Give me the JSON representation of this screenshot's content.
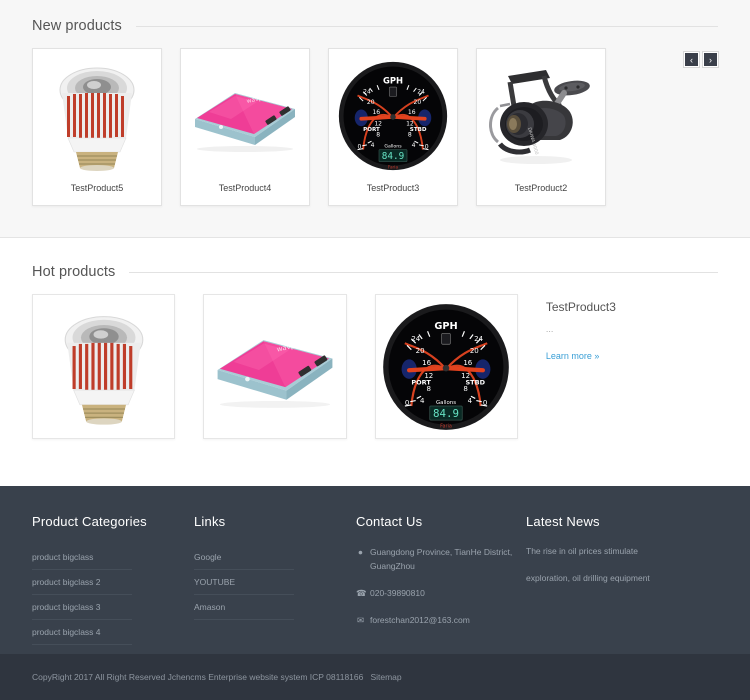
{
  "sections": {
    "new": {
      "title": "New products",
      "prev_label": "‹",
      "next_label": "›",
      "products": [
        {
          "name": "TestProduct5",
          "art": "led-bulb"
        },
        {
          "name": "TestProduct4",
          "art": "pink-device"
        },
        {
          "name": "TestProduct3",
          "art": "gph-gauge"
        },
        {
          "name": "TestProduct2",
          "art": "fishing-reel"
        }
      ]
    },
    "hot": {
      "title": "Hot products",
      "products": [
        {
          "art": "led-bulb"
        },
        {
          "art": "pink-device"
        },
        {
          "art": "gph-gauge"
        }
      ],
      "detail": {
        "title": "TestProduct3",
        "description": "...",
        "link_label": "Learn more »"
      }
    }
  },
  "gauge": {
    "brand": "GPH",
    "left_label": "PORT",
    "right_label": "STBD",
    "unit_label": "Gallons",
    "readout": "84.9",
    "ticks": [
      "0",
      "4",
      "8",
      "12",
      "16",
      "20",
      "24"
    ]
  },
  "footer": {
    "columns": [
      {
        "heading": "Product Categories",
        "links": [
          "product bigclass",
          "product bigclass 2",
          "product bigclass 3",
          "product bigclass 4"
        ]
      },
      {
        "heading": "Links",
        "links": [
          "Google",
          "YOUTUBE",
          "Amason"
        ]
      }
    ],
    "contact": {
      "heading": "Contact Us",
      "address": "Guangdong Province, TianHe District, GuangZhou",
      "phone": "020-39890810",
      "email": "forestchan2012@163.com",
      "icons": {
        "address": "location-pin-icon",
        "phone": "phone-icon",
        "email": "envelope-icon"
      }
    },
    "news": {
      "heading": "Latest News",
      "items": [
        "The rise in oil prices stimulate",
        "exploration, oil drilling equipment"
      ]
    }
  },
  "copyright": {
    "text": "CopyRight 2017 All Right Reserved Jchencms Enterprise website system ICP 08118166",
    "sitemap_label": "Sitemap"
  },
  "colors": {
    "band_background": "#f7f7f7",
    "footer_background": "#39414c",
    "copybar_background": "#2f353f",
    "link_accent": "#3a9fd6",
    "arrow_background": "#3a3f4a"
  }
}
